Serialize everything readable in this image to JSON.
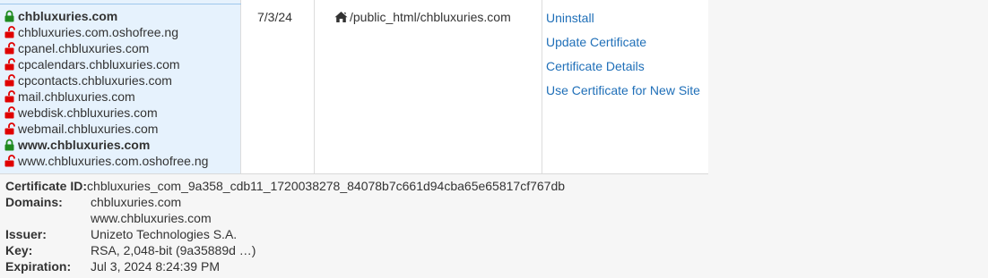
{
  "table": {
    "domains": [
      {
        "name": "chbluxuries.com",
        "status": "secured",
        "bold": true
      },
      {
        "name": "chbluxuries.com.oshofree.ng",
        "status": "unsecured",
        "bold": false
      },
      {
        "name": "cpanel.chbluxuries.com",
        "status": "unsecured",
        "bold": false
      },
      {
        "name": "cpcalendars.chbluxuries.com",
        "status": "unsecured",
        "bold": false
      },
      {
        "name": "cpcontacts.chbluxuries.com",
        "status": "unsecured",
        "bold": false
      },
      {
        "name": "mail.chbluxuries.com",
        "status": "unsecured",
        "bold": false
      },
      {
        "name": "webdisk.chbluxuries.com",
        "status": "unsecured",
        "bold": false
      },
      {
        "name": "webmail.chbluxuries.com",
        "status": "unsecured",
        "bold": false
      },
      {
        "name": "www.chbluxuries.com",
        "status": "secured",
        "bold": true
      },
      {
        "name": "www.chbluxuries.com.oshofree.ng",
        "status": "unsecured",
        "bold": false
      }
    ],
    "date": "7/3/24",
    "path_icon": "home-icon",
    "path": "/public_html/chbluxuries.com",
    "actions": [
      "Uninstall",
      "Update Certificate",
      "Certificate Details",
      "Use Certificate for New Site"
    ]
  },
  "details": {
    "cert_id_label": "Certificate ID:",
    "cert_id": "chbluxuries_com_9a358_cdb11_1720038278_84078b7c661d94cba65e65817cf767db",
    "domains_label": "Domains:",
    "domains": [
      "chbluxuries.com",
      "www.chbluxuries.com"
    ],
    "issuer_label": "Issuer:",
    "issuer": "Unizeto Technologies S.A.",
    "key_label": "Key:",
    "key": "RSA, 2,048-bit (9a35889d …)",
    "expiration_label": "Expiration:",
    "expiration": "Jul 3, 2024 8:24:39 PM"
  },
  "colors": {
    "secured_lock": "#1f8a1f",
    "unsecured_lock": "#e00000",
    "link": "#1f6fb8",
    "selected_bg": "#e6f2fd"
  }
}
